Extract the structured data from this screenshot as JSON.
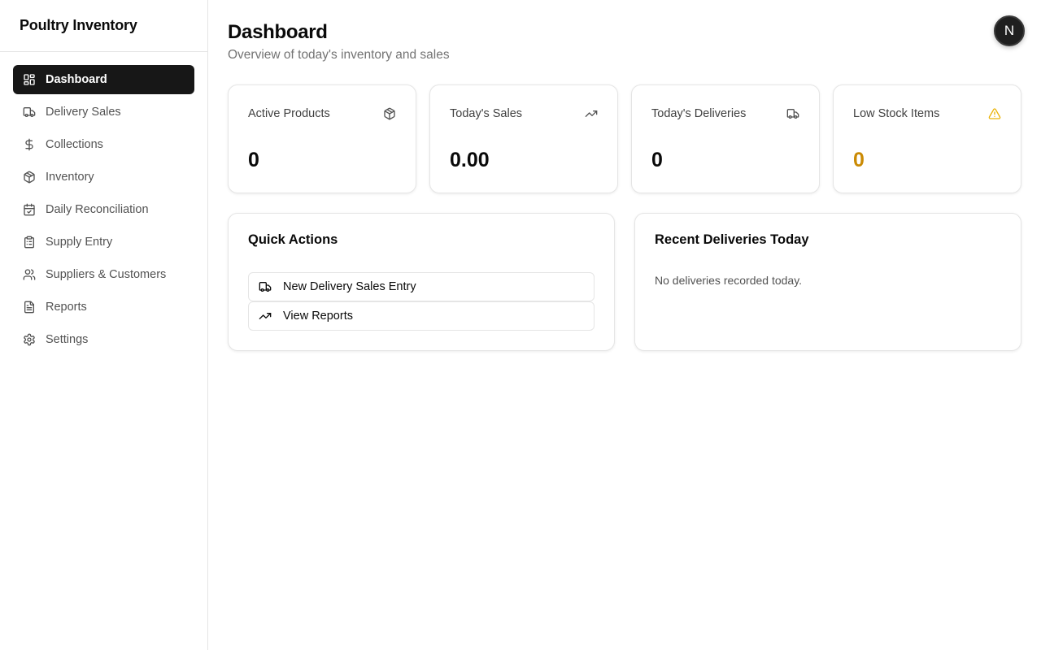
{
  "app": {
    "title": "Poultry Inventory"
  },
  "sidebar": {
    "items": [
      {
        "label": "Dashboard",
        "icon": "dashboard-icon",
        "active": true
      },
      {
        "label": "Delivery Sales",
        "icon": "truck-icon"
      },
      {
        "label": "Collections",
        "icon": "dollar-icon"
      },
      {
        "label": "Inventory",
        "icon": "package-icon"
      },
      {
        "label": "Daily Reconciliation",
        "icon": "calendar-check-icon"
      },
      {
        "label": "Supply Entry",
        "icon": "clipboard-icon"
      },
      {
        "label": "Suppliers & Customers",
        "icon": "users-icon"
      },
      {
        "label": "Reports",
        "icon": "file-text-icon"
      },
      {
        "label": "Settings",
        "icon": "gear-icon"
      }
    ]
  },
  "header": {
    "title": "Dashboard",
    "subtitle": "Overview of today's inventory and sales",
    "avatar_initial": "N"
  },
  "stats": [
    {
      "label": "Active Products",
      "value": "0",
      "icon": "package-icon"
    },
    {
      "label": "Today's Sales",
      "value": "0.00",
      "icon": "trending-up-icon"
    },
    {
      "label": "Today's Deliveries",
      "value": "0",
      "icon": "truck-icon"
    },
    {
      "label": "Low Stock Items",
      "value": "0",
      "icon": "warning-icon",
      "color": "#ca8a04"
    }
  ],
  "quick_actions": {
    "title": "Quick Actions",
    "buttons": [
      {
        "label": "New Delivery Sales Entry",
        "icon": "truck-icon"
      },
      {
        "label": "View Reports",
        "icon": "trending-up-icon"
      }
    ]
  },
  "recent_deliveries": {
    "title": "Recent Deliveries Today",
    "empty_text": "No deliveries recorded today."
  },
  "colors": {
    "active_nav_bg": "#171717",
    "warning": "#ca8a04",
    "border": "#e5e5e5"
  }
}
